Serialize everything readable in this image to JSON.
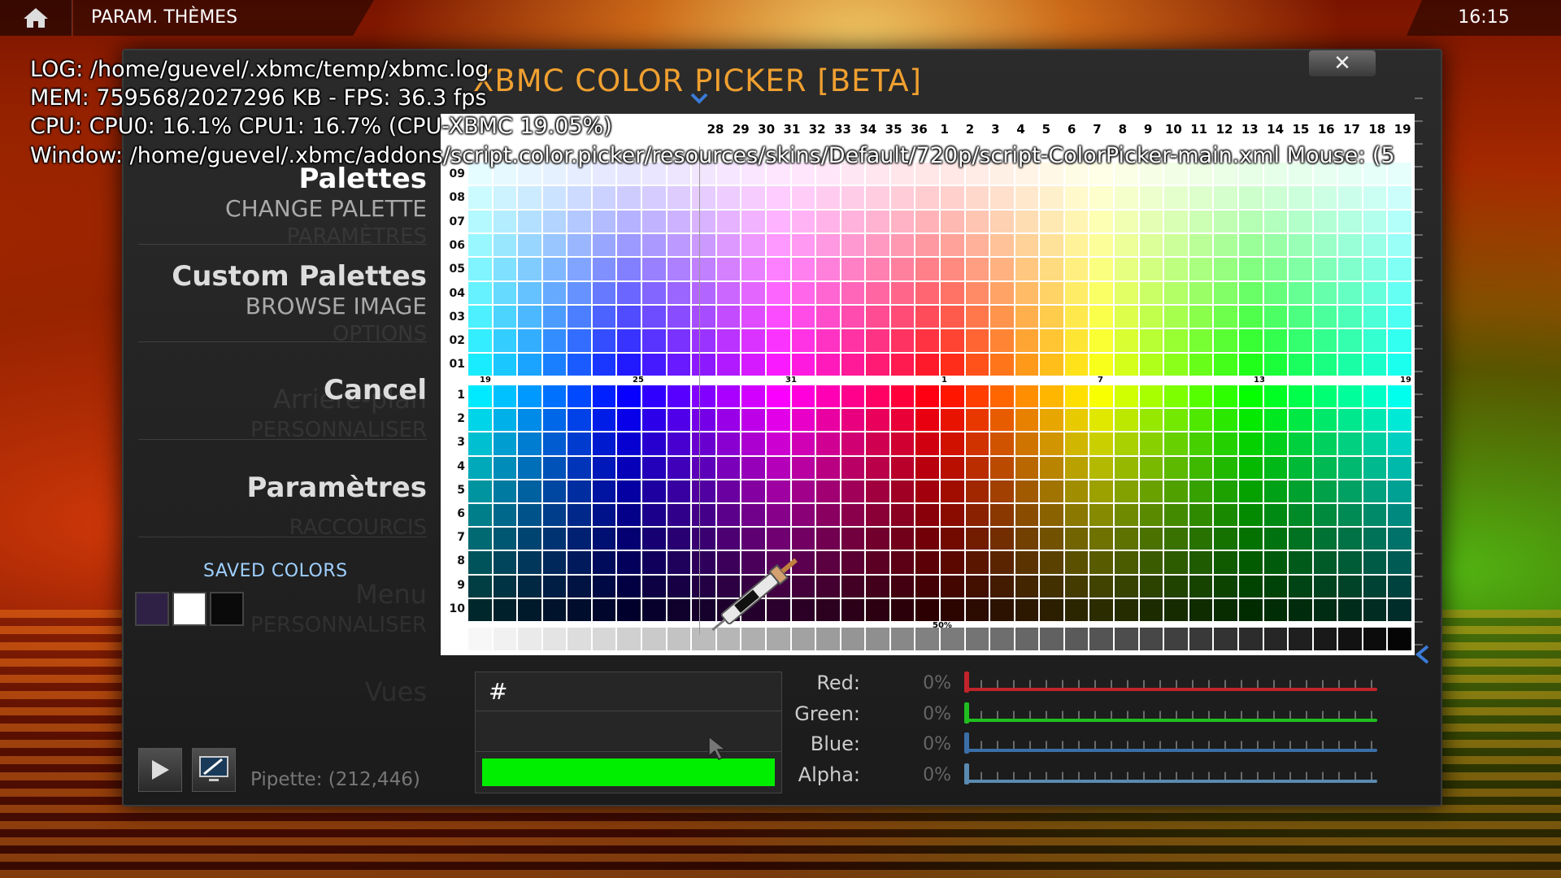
{
  "topbar": {
    "breadcrumb": "PARAM. THÈMES",
    "clock": "16:15"
  },
  "dialog": {
    "title": "XBMC COLOR PICKER [BETA]",
    "close_label": "✕"
  },
  "debug": {
    "log": "LOG: /home/guevel/.xbmc/temp/xbmc.log",
    "mem": "MEM: 759568/2027296 KB - FPS: 36.3 fps",
    "cpu": "CPU: CPU0: 16.1% CPU1: 16.7%  (CPU-XBMC 19.05%)",
    "window": "Window: /home/guevel/.xbmc/addons/script.color.picker/resources/skins/Default/720p/script-ColorPicker-main.xml  Mouse: (5"
  },
  "menu": {
    "palettes": "Palettes",
    "change_palette": "CHANGE PALETTE",
    "custom_palettes": "Custom Palettes",
    "browse_image": "BROWSE IMAGE",
    "cancel": "Cancel",
    "parametres": "Paramètres"
  },
  "ghost_menu": {
    "parametres": "PARAMÈTRES",
    "options": "OPTIONS",
    "arriere_plan": "Arrière-plan",
    "personnaliser": "PERSONNALISER",
    "raccourcis": "RACCOURCIS",
    "menu": "Menu",
    "personnaliser2": "PERSONNALISER",
    "vues": "Vues"
  },
  "saved_colors": {
    "label": "SAVED COLORS",
    "swatches": [
      "#2e2145",
      "#ffffff",
      "#0a0a0a"
    ]
  },
  "pipette_text": "Pipette: (212,446)",
  "palette": {
    "header_numbers": [
      "28",
      "29",
      "30",
      "31",
      "32",
      "33",
      "34",
      "35",
      "36",
      "1",
      "2",
      "3",
      "4",
      "5",
      "6",
      "7",
      "8",
      "9",
      "10",
      "11",
      "12",
      "13",
      "14",
      "15",
      "16",
      "17",
      "18",
      "19"
    ],
    "top_rows": [
      "09",
      "08",
      "07",
      "06",
      "05",
      "04",
      "03",
      "02",
      "01"
    ],
    "bottom_rows": [
      "1",
      "2",
      "3",
      "4",
      "5",
      "6",
      "7",
      "8",
      "9",
      "10"
    ],
    "mid_markers": [
      "19",
      "25",
      "31",
      "1",
      "7",
      "13",
      "19"
    ],
    "gray_label": "50%"
  },
  "controls": {
    "hex_prefix": "#",
    "preview_color": "#00ee00",
    "sliders": [
      {
        "label": "Red:",
        "pct": "0%",
        "color": "#c0242a"
      },
      {
        "label": "Green:",
        "pct": "0%",
        "color": "#1fbf1f"
      },
      {
        "label": "Blue:",
        "pct": "0%",
        "color": "#3b6ea8"
      },
      {
        "label": "Alpha:",
        "pct": "0%",
        "color": "#5a8ab0"
      }
    ]
  }
}
